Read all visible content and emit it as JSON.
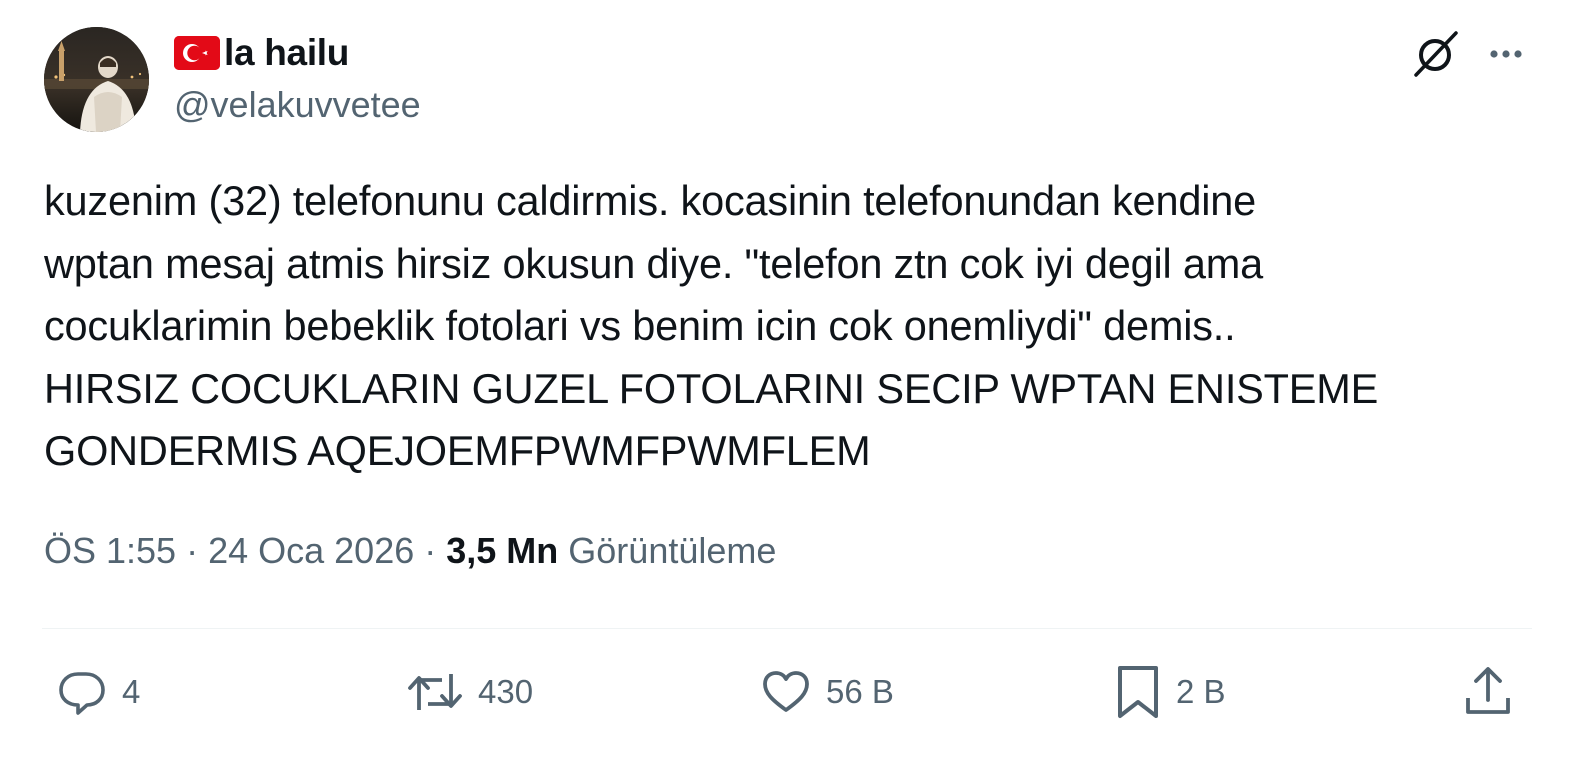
{
  "author": {
    "display_name": "la hailu",
    "handle": "@velakuvvetee",
    "flag_icon": "turkey-flag-icon",
    "avatar_icon": "profile-photo"
  },
  "header_icons": {
    "grok": "grok-icon",
    "more": "more-options-icon"
  },
  "tweet": {
    "text": "kuzenim (32) telefonunu caldirmis. kocasinin telefonundan kendine\nwptan mesaj atmis hirsiz okusun diye. \"telefon ztn cok iyi degil ama\ncocuklarimin bebeklik fotolari vs benim icin cok onemliydi\" demis..\nHIRSIZ COCUKLARIN GUZEL FOTOLARINI SECIP WPTAN ENISTEME\nGONDERMIS AQEJOEMFPWMFPWMFLEM"
  },
  "meta": {
    "time": "ÖS 1:55",
    "separator": "·",
    "date": "24 Oca 2026",
    "views_count": "3,5 Mn",
    "views_label": "Görüntüleme"
  },
  "actions": {
    "reply_count": "4",
    "repost_count": "430",
    "like_count": "56 B",
    "bookmark_count": "2 B"
  },
  "colors": {
    "text_primary": "#0f1419",
    "text_secondary": "#536471",
    "divider": "#eff3f4",
    "flag_red": "#e30a17"
  }
}
